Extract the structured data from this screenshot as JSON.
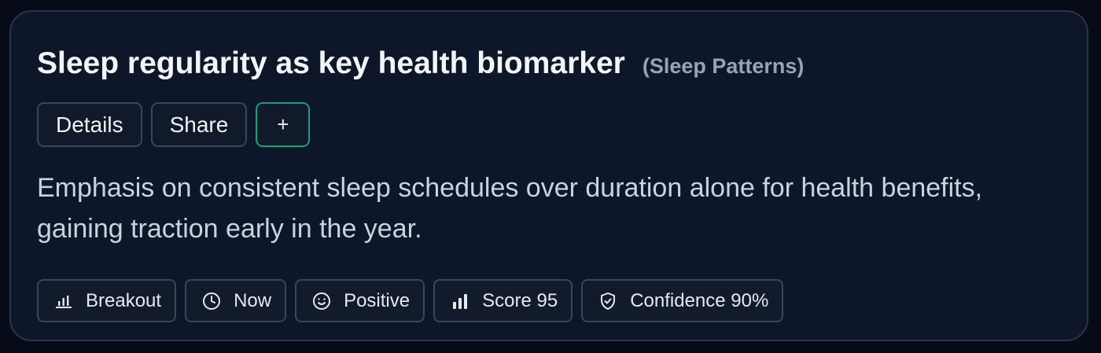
{
  "card": {
    "title": "Sleep regularity as key health biomarker",
    "category": "(Sleep Patterns)",
    "actions": {
      "details_label": "Details",
      "share_label": "Share",
      "add_label": "+"
    },
    "description": "Emphasis on consistent sleep schedules over duration alone for health benefits, gaining traction early in the year.",
    "tags": [
      {
        "label": "Breakout",
        "icon": "bar-chart-icon"
      },
      {
        "label": "Now",
        "icon": "clock-icon"
      },
      {
        "label": "Positive",
        "icon": "smile-icon"
      },
      {
        "label": "Score 95",
        "icon": "signal-bars-icon"
      },
      {
        "label": "Confidence 90%",
        "icon": "shield-check-icon"
      }
    ]
  },
  "colors": {
    "background": "#060b17",
    "card": "#0e1729",
    "border": "#2a3546",
    "accent": "#1f9b80",
    "muted": "#93a4ba"
  }
}
